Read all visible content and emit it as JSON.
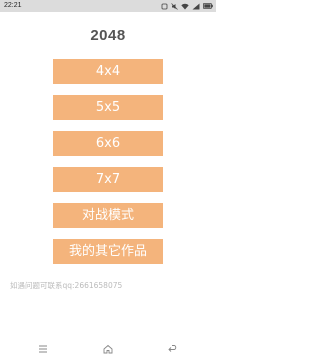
{
  "status_bar": {
    "time": "22:21",
    "icons": [
      "notification-icon",
      "mute-icon",
      "wifi-icon",
      "signal-icon",
      "battery-icon"
    ]
  },
  "title": "2048",
  "menu": {
    "buttons": [
      {
        "label": "4x4"
      },
      {
        "label": "5x5"
      },
      {
        "label": "6x6"
      },
      {
        "label": "7x7"
      },
      {
        "label": "对战模式"
      },
      {
        "label": "我的其它作品"
      }
    ]
  },
  "footer": {
    "contact": "如遇问题可联系qq:2661658075"
  },
  "nav_bar": {
    "icons": [
      "menu-icon",
      "home-icon",
      "back-icon"
    ]
  },
  "colors": {
    "button_bg": "#f4b47c",
    "button_text": "#ffffff",
    "title": "#555555",
    "footer_text": "#bbbbbb",
    "status_bar_bg": "#dcdcdc"
  }
}
